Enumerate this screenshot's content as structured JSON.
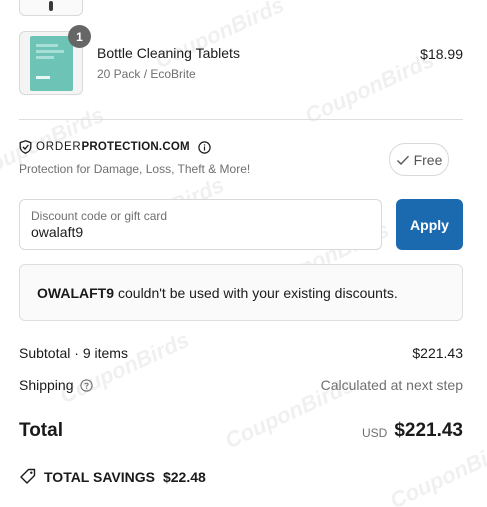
{
  "watermark_text": "CouponBirds",
  "line_item": {
    "quantity_badge": "1",
    "name": "Bottle Cleaning Tablets",
    "variant": "20 Pack / EcoBrite",
    "price": "$18.99",
    "thumbnail_color": "#6cc3b6"
  },
  "order_protection": {
    "brand_thin": "ORDER",
    "brand_bold": "PROTECTION.COM",
    "tagline": "Protection for Damage, Loss, Theft & More!",
    "option_label": "Free"
  },
  "discount": {
    "field_label": "Discount code or gift card",
    "field_value": "owalaft9",
    "apply_label": "Apply",
    "apply_color": "#1b6ab0"
  },
  "error": {
    "code": "OWALAFT9",
    "message": "couldn't be used with your existing discounts."
  },
  "summary": {
    "subtotal_label": "Subtotal · 9 items",
    "subtotal_value": "$221.43",
    "shipping_label": "Shipping",
    "shipping_value": "Calculated at next step",
    "total_label": "Total",
    "total_currency": "USD",
    "total_value": "$221.43",
    "savings_label": "TOTAL SAVINGS",
    "savings_value": "$22.48"
  }
}
